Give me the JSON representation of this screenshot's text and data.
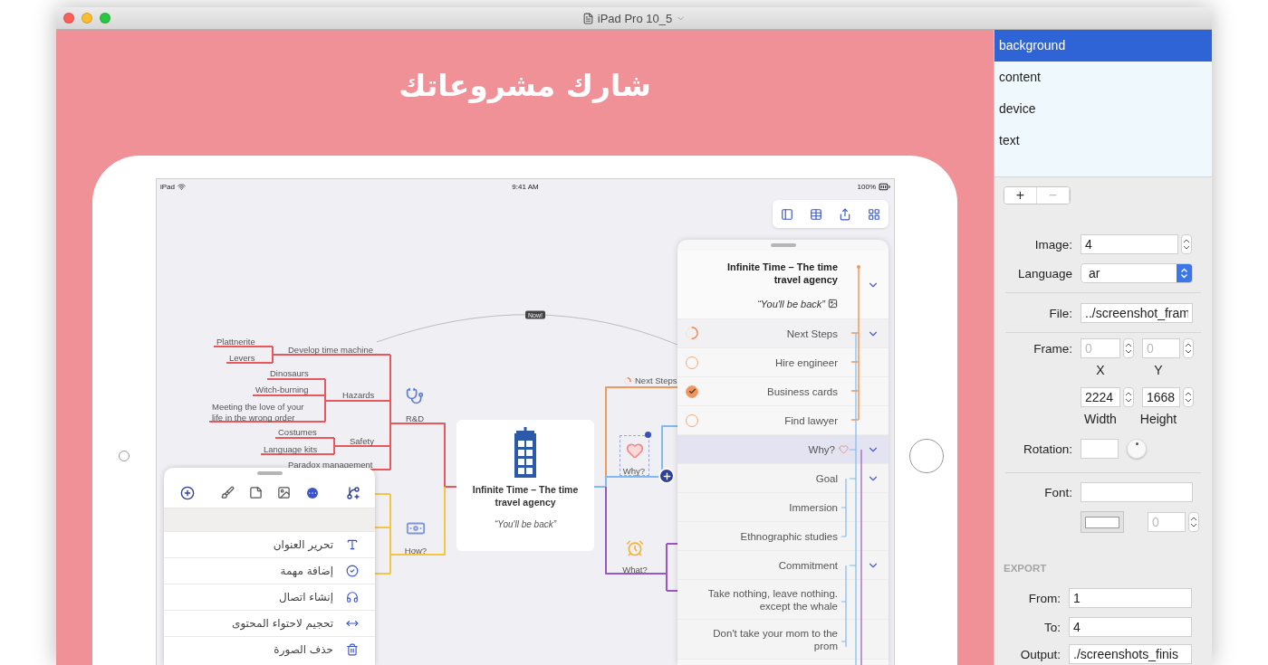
{
  "window": {
    "title": "iPad Pro 10_5"
  },
  "canvas": {
    "headline": "شارك مشروعاتك"
  },
  "device": {
    "status_bar": {
      "carrier": "iPad",
      "time": "9:41 AM",
      "battery": "100%"
    },
    "mind_map": {
      "connector_label": "Now!",
      "central_topic": {
        "title": "Infinite Time – The time travel agency",
        "note": "“You'll be back”"
      },
      "topics": [
        {
          "label": "Plattnerite"
        },
        {
          "label": "Levers"
        },
        {
          "label": "Develop time machine"
        },
        {
          "label": "Dinosaurs"
        },
        {
          "label": "Witch-burning"
        },
        {
          "label": "Hazards"
        },
        {
          "label": "Meeting the love of your life in the wrong order"
        },
        {
          "label": "Costumes"
        },
        {
          "label": "Language kits"
        },
        {
          "label": "Safety"
        },
        {
          "label": "Paradox management"
        }
      ],
      "branches": [
        {
          "label": "R&D"
        },
        {
          "label": "Next Steps"
        },
        {
          "label": "Why?"
        },
        {
          "label": "How?"
        },
        {
          "label": "What?"
        }
      ]
    },
    "outline": {
      "rows": [
        {
          "kind": "header",
          "title": "Infinite Time – The time travel agency",
          "note": "“You'll be back”",
          "expanded": true,
          "selected": false
        },
        {
          "kind": "task-group",
          "label": "Next Steps",
          "level": 0.5,
          "expanded": true,
          "selected": false
        },
        {
          "kind": "task",
          "label": "Hire engineer",
          "checked": false,
          "selected": false
        },
        {
          "kind": "task",
          "label": "Business cards",
          "checked": true,
          "selected": false
        },
        {
          "kind": "task",
          "label": "Find lawyer",
          "checked": false,
          "selected": false
        },
        {
          "kind": "heart-topic",
          "label": "Why?",
          "expanded": true,
          "selected": true
        },
        {
          "kind": "topic",
          "label": "Goal",
          "expanded": true,
          "selected": false
        },
        {
          "kind": "topic",
          "label": "Immersion",
          "selected": false
        },
        {
          "kind": "topic",
          "label": "Ethnographic studies",
          "selected": false
        },
        {
          "kind": "topic",
          "label": "Commitment",
          "expanded": true,
          "selected": false
        },
        {
          "kind": "topic",
          "label": "Take nothing, leave nothing. except the whale",
          "selected": false
        },
        {
          "kind": "topic",
          "label": "Don't take your mom to the prom",
          "selected": false
        }
      ]
    },
    "action_sheet": {
      "actions": [
        {
          "label": "تحرير العنوان"
        },
        {
          "label": "إضافة مهمة"
        },
        {
          "label": "إنشاء اتصال"
        },
        {
          "label": "تحجيم لاحتواء المحتوى"
        },
        {
          "label": "حذف الصورة"
        }
      ]
    }
  },
  "sidebar": {
    "layers": [
      {
        "label": "background",
        "selected": true
      },
      {
        "label": "content",
        "selected": false
      },
      {
        "label": "device",
        "selected": false
      },
      {
        "label": "text",
        "selected": false
      }
    ],
    "layer_buttons": [
      {
        "label": "+",
        "disabled": false
      },
      {
        "label": "−",
        "disabled": true
      }
    ],
    "inspector": {
      "image": {
        "label": "Image:",
        "value": "4"
      },
      "language": {
        "label": "Language",
        "value": "ar"
      },
      "file": {
        "label": "File:",
        "value": "../screenshot_fram"
      },
      "frame": {
        "label": "Frame:",
        "x": {
          "caption": "X",
          "value": "0",
          "disabled": true
        },
        "y": {
          "caption": "Y",
          "value": "0",
          "disabled": true
        },
        "width": {
          "caption": "Width",
          "value": "2224",
          "disabled": false
        },
        "height": {
          "caption": "Height",
          "value": "1668",
          "disabled": false
        }
      },
      "rotation": {
        "label": "Rotation:"
      },
      "font": {
        "label": "Font:",
        "size": {
          "value": "0",
          "disabled": true
        }
      },
      "export": {
        "heading": "EXPORT",
        "from": {
          "label": "From:",
          "value": "1"
        },
        "to": {
          "label": "To:",
          "value": "4"
        },
        "output": {
          "label": "Output:",
          "value": "./screenshots_finis"
        }
      }
    }
  }
}
